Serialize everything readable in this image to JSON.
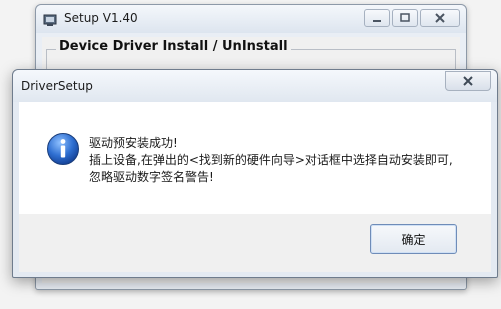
{
  "background_window": {
    "title": "Setup V1.40",
    "group_title": "Device Driver Install / UnInstall"
  },
  "dialog": {
    "title": "DriverSetup",
    "message_line1": "驱动预安装成功!",
    "message_line2": "插上设备,在弹出的<找到新的硬件向导>对话框中选择自动安装即可,",
    "message_line3": "忽略驱动数字签名警告!",
    "ok_label": "确定",
    "icon": "info-icon"
  }
}
